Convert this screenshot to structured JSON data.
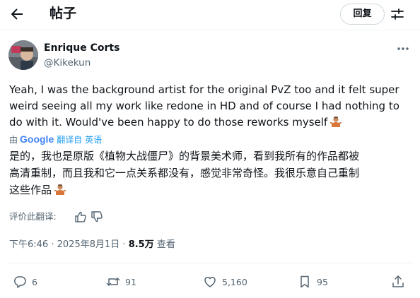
{
  "header": {
    "title": "帖子",
    "reply_label": "回复"
  },
  "author": {
    "name": "Enrique Corts",
    "handle": "@Kikekun"
  },
  "tweet": {
    "text_en": "Yeah, I was the background artist for the original PvZ too and it felt super\nweird seeing all my work like redone in HD and of course I had nothing to\ndo with it. Would've been happy to do those reworks myself",
    "translation": {
      "by_label": "由",
      "provider": "Google",
      "link_label": "翻译自 英语"
    },
    "text_zh": "是的，我也是原版《植物大战僵尸》的背景美术师，看到我所有的作品都被\n高清重制，而且我和它一点关系都没有，感觉非常奇怪。我很乐意自己重制\n这些作品"
  },
  "rate_label": "评价此翻译:",
  "meta": {
    "time": "下午6:46",
    "separator": "·",
    "date": "2025年8月1日",
    "views_count": "8.5万",
    "views_label": "查看"
  },
  "actions": {
    "replies": "6",
    "reposts": "91",
    "likes": "5,160",
    "bookmarks": "95"
  },
  "colors": {
    "text": "#0f1419",
    "secondary": "#536471",
    "link": "#1d9bf0",
    "divider": "#eff3f4"
  },
  "icons": [
    "back-arrow-icon",
    "settings-icon",
    "more-icon",
    "person-shrugging-emoji",
    "thumbs-up-icon",
    "thumbs-down-icon",
    "reply-icon",
    "repost-icon",
    "like-icon",
    "bookmark-icon",
    "share-icon"
  ]
}
